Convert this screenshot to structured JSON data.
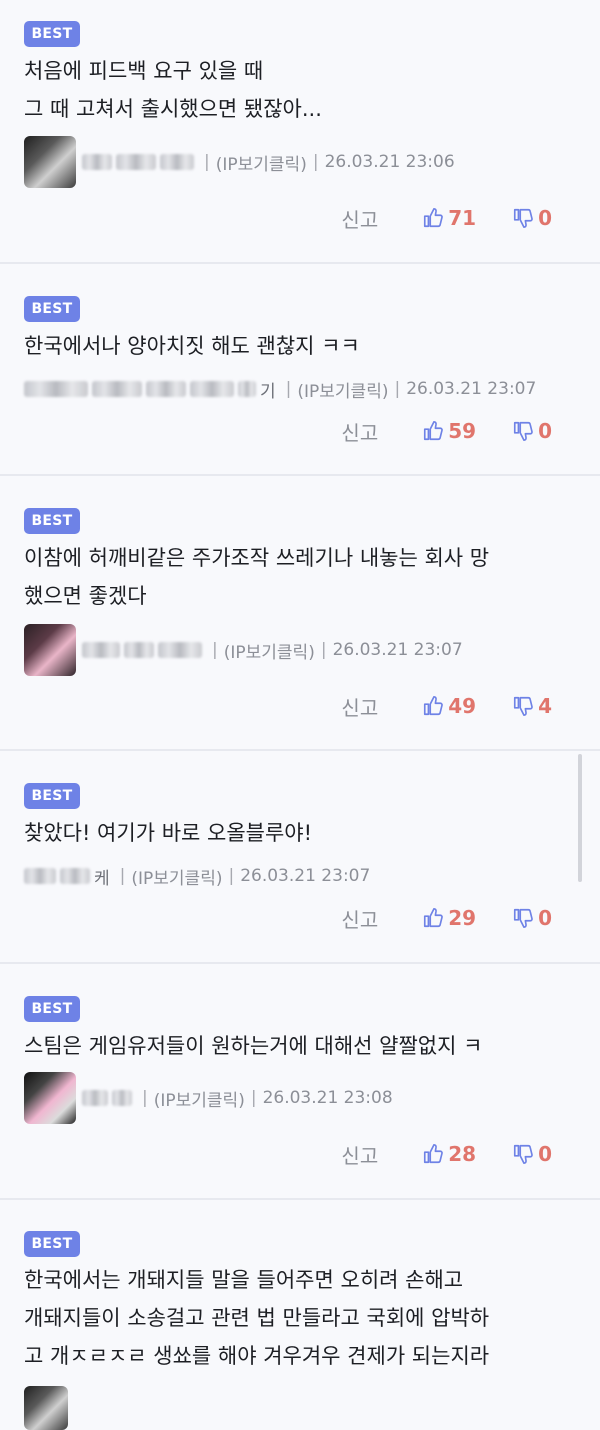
{
  "badge": "BEST",
  "report_label": "신고",
  "comments": [
    {
      "body": "처음에 피드백 요구 있을 때\n그 때 고쳐서 출시했으면 됐잖아...",
      "nick_tail": "",
      "ip": "(IP보기클릭)",
      "date": "26.03.21 23:06",
      "up": "71",
      "down": "0"
    },
    {
      "body": "한국에서나 양아치짓 해도 괜찮지 ㅋㅋ",
      "nick_tail": "기",
      "ip": "(IP보기클릭)",
      "date": "26.03.21 23:07",
      "up": "59",
      "down": "0"
    },
    {
      "body": "이참에 허깨비같은 주가조작 쓰레기나 내놓는 회사 망\n했으면 좋겠다",
      "nick_tail": "",
      "ip": "(IP보기클릭)",
      "date": "26.03.21 23:07",
      "up": "49",
      "down": "4"
    },
    {
      "body": "찾았다! 여기가 바로 오올블루야!",
      "nick_tail": "케",
      "ip": "(IP보기클릭)",
      "date": "26.03.21 23:07",
      "up": "29",
      "down": "0"
    },
    {
      "body": "스팀은 게임유저들이 원하는거에 대해선 얄짤없지 ㅋ",
      "nick_tail": "",
      "ip": "(IP보기클릭)",
      "date": "26.03.21 23:08",
      "up": "28",
      "down": "0"
    },
    {
      "body": "한국에서는 개돼지들 말을 들어주면 오히려 손해고\n개돼지들이 소송걸고 관련 법 만들라고 국회에 압박하\n고 개ㅈㄹㅈㄹ 생쑈를 해야 겨우겨우 견제가 되는지라"
    }
  ],
  "colors": {
    "badge": "#6e82e6",
    "vote": "#e0756c",
    "vote_icon": "#6e82e6",
    "background": "#f8f9fc"
  }
}
